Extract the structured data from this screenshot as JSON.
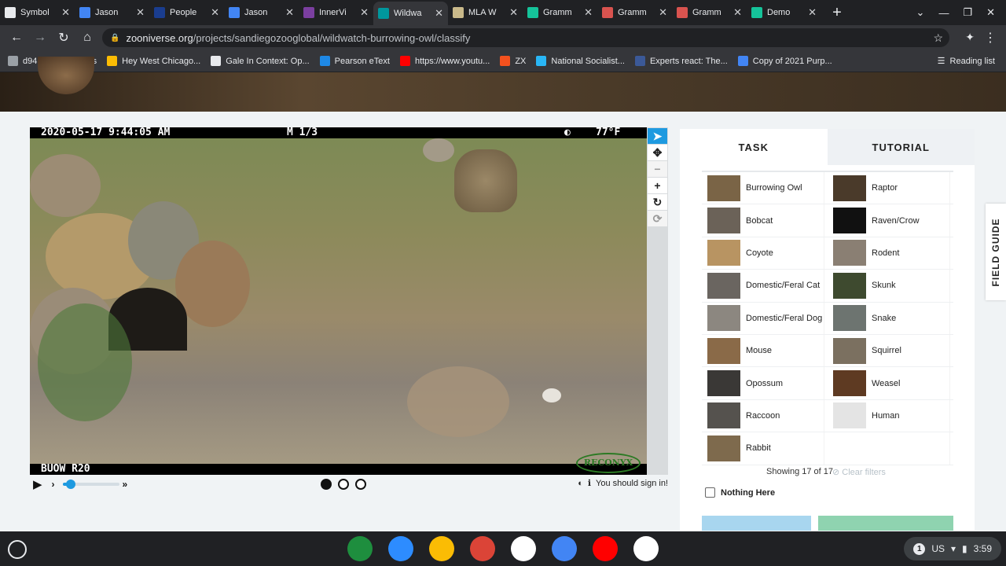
{
  "browser": {
    "tabs": [
      {
        "title": "Symbol",
        "color": "#e8eaed"
      },
      {
        "title": "Jason",
        "color": "#4285f4"
      },
      {
        "title": "People",
        "color": "#1a3d8f"
      },
      {
        "title": "Jason",
        "color": "#4285f4"
      },
      {
        "title": "InnerVi",
        "color": "#7b3fa0"
      },
      {
        "title": "Wildwa",
        "color": "#00979d"
      },
      {
        "title": "MLA W",
        "color": "#c9b98a"
      },
      {
        "title": "Gramm",
        "color": "#15c39a"
      },
      {
        "title": "Gramm",
        "color": "#d9534f"
      },
      {
        "title": "Gramm",
        "color": "#d9534f"
      },
      {
        "title": "Demo",
        "color": "#15c39a"
      }
    ],
    "new_tab": "+",
    "url_host": "zooniverse.org",
    "url_path": "/projects/sandiegozooglobal/wildwatch-burrowing-owl/classify",
    "bookmarks": [
      {
        "label": "d94.org bookmarks",
        "color": "#9aa0a6"
      },
      {
        "label": "Hey West Chicago...",
        "color": "#fbbc04"
      },
      {
        "label": "Gale In Context: Op...",
        "color": "#e8eaed"
      },
      {
        "label": "Pearson eText",
        "color": "#1e88e5"
      },
      {
        "label": "https://www.youtu...",
        "color": "#ff0000"
      },
      {
        "label": "ZX",
        "color": "#f4511e"
      },
      {
        "label": "National Socialist...",
        "color": "#29b6f6"
      },
      {
        "label": "Experts react: The...",
        "color": "#3b5998"
      },
      {
        "label": "Copy of 2021 Purp...",
        "color": "#4285f4"
      }
    ],
    "reading_list": "Reading list"
  },
  "subject": {
    "timestamp": "2020-05-17  9:44:05 AM",
    "frame": "M 1/3",
    "temperature": "77°F",
    "camera_id": "BUOW R20",
    "brand": "RECONYX"
  },
  "controls": {
    "frame_dots": [
      true,
      false,
      false
    ],
    "slider_fraction": 0.15,
    "sign_in": "You should sign in!"
  },
  "panel": {
    "tabs": [
      "TASK",
      "TUTORIAL"
    ],
    "species": [
      {
        "left": "Burrowing Owl",
        "left_color": "#7a6446",
        "right": "Raptor",
        "right_color": "#4a3a2a"
      },
      {
        "left": "Bobcat",
        "left_color": "#6b6258",
        "right": "Raven/Crow",
        "right_color": "#111111"
      },
      {
        "left": "Coyote",
        "left_color": "#b89462",
        "right": "Rodent",
        "right_color": "#8a7f73"
      },
      {
        "left": "Domestic/Feral Cat",
        "left_color": "#6a6560",
        "right": "Skunk",
        "right_color": "#3e4a2f"
      },
      {
        "left": "Domestic/Feral Dog",
        "left_color": "#8c8780",
        "right": "Snake",
        "right_color": "#6d7470"
      },
      {
        "left": "Mouse",
        "left_color": "#8a6a48",
        "right": "Squirrel",
        "right_color": "#7b7060"
      },
      {
        "left": "Opossum",
        "left_color": "#3a3836",
        "right": "Weasel",
        "right_color": "#5e3a22"
      },
      {
        "left": "Raccoon",
        "left_color": "#55524e",
        "right": "Human",
        "right_color": "#e4e4e4"
      },
      {
        "left": "Rabbit",
        "left_color": "#7e6a4d",
        "right": "",
        "right_color": ""
      }
    ],
    "showing": "Showing 17 of 17",
    "clear_filters": "Clear filters",
    "nothing_here": "Nothing Here",
    "field_guide": "FIELD GUIDE"
  },
  "shelf": {
    "apps": [
      {
        "name": "classroom",
        "color": "#1e8e3e"
      },
      {
        "name": "zoom",
        "color": "#2d8cff"
      },
      {
        "name": "slides",
        "color": "#fbbc04"
      },
      {
        "name": "chrome",
        "color": "#db4437"
      },
      {
        "name": "gmail",
        "color": "#ffffff"
      },
      {
        "name": "docs",
        "color": "#4285f4"
      },
      {
        "name": "youtube",
        "color": "#ff0000"
      },
      {
        "name": "play",
        "color": "#ffffff"
      }
    ],
    "locale": "US",
    "time": "3:59",
    "notifications": "1"
  }
}
